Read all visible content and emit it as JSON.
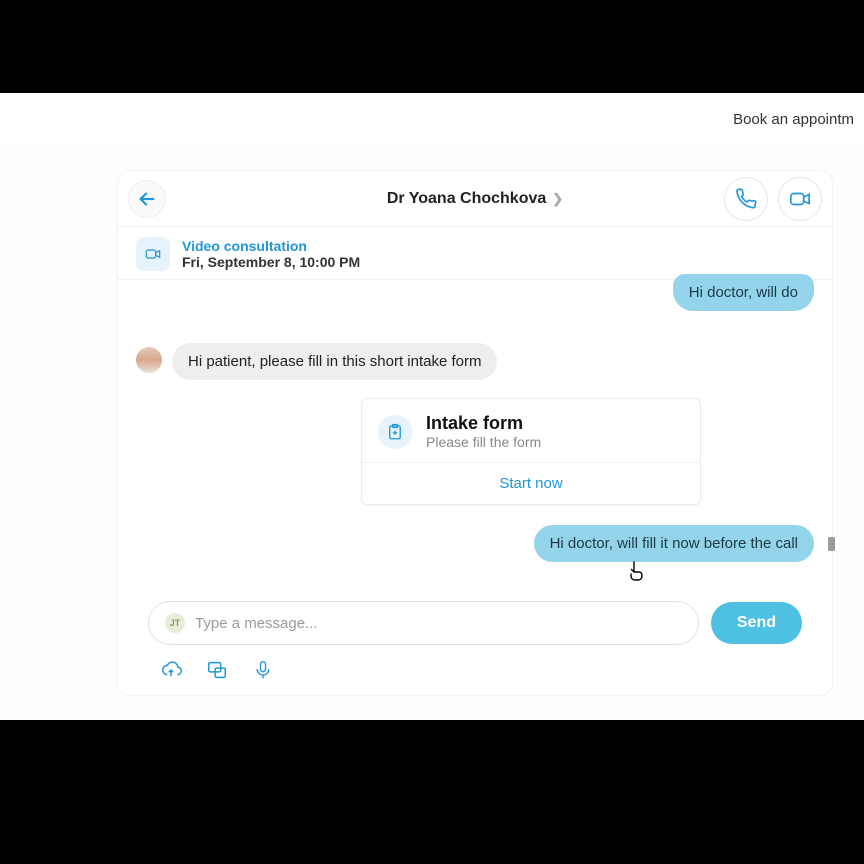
{
  "topbar": {
    "book_link": "Book an appointm"
  },
  "header": {
    "title": "Dr Yoana Chochkova"
  },
  "banner": {
    "title": "Video consultation",
    "subtitle": "Fri, September 8, 10:00 PM"
  },
  "messages": {
    "out1": "Hi doctor, will do",
    "in1": "Hi patient, please fill in this short intake form",
    "out2": "Hi doctor, will fill it now before the call"
  },
  "card": {
    "title": "Intake form",
    "subtitle": "Please fill the form",
    "action": "Start now"
  },
  "composer": {
    "placeholder": "Type a message...",
    "send_label": "Send",
    "badge": "JT"
  },
  "colors": {
    "accent": "#2196d8",
    "bubbleOut": "#94d4ea",
    "send": "#4ec0e4"
  }
}
